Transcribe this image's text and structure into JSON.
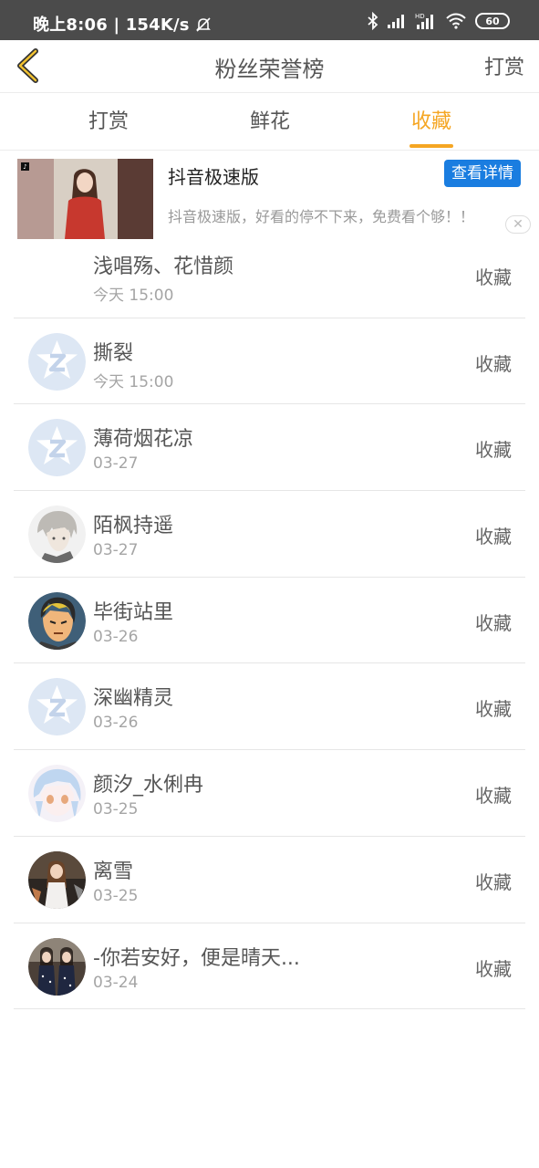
{
  "status": {
    "time": "晚上8:06",
    "speed": "154K/s",
    "battery": "60"
  },
  "header": {
    "title": "粉丝荣誉榜",
    "right_label": "打赏"
  },
  "tabs": [
    {
      "label": "打赏"
    },
    {
      "label": "鲜花"
    },
    {
      "label": "收藏"
    }
  ],
  "ad": {
    "title": "抖音极速版",
    "button": "查看详情",
    "desc": "抖音极速版，好看的停不下来，免费看个够！！"
  },
  "rows": [
    {
      "name": "浅唱殇、花惜颜",
      "date": "今天 15:00",
      "action": "收藏",
      "avatar": "hidden"
    },
    {
      "name": "撕裂",
      "date": "今天 15:00",
      "action": "收藏",
      "avatar": "default-q-icon"
    },
    {
      "name": "薄荷烟花凉",
      "date": "03-27",
      "action": "收藏",
      "avatar": "default-q-icon"
    },
    {
      "name": "陌枫持遥",
      "date": "03-27",
      "action": "收藏",
      "avatar": "anime-boy"
    },
    {
      "name": "毕街站里",
      "date": "03-26",
      "action": "收藏",
      "avatar": "cartoon-man"
    },
    {
      "name": "深幽精灵",
      "date": "03-26",
      "action": "收藏",
      "avatar": "default-q-icon"
    },
    {
      "name": "颜汐_水俐冉",
      "date": "03-25",
      "action": "收藏",
      "avatar": "anime-girl"
    },
    {
      "name": "离雪",
      "date": "03-25",
      "action": "收藏",
      "avatar": "photo-girl"
    },
    {
      "name": "-你若安好，便是晴天...",
      "date": "03-24",
      "action": "收藏",
      "avatar": "photo-group"
    }
  ],
  "colors": {
    "accent": "#f5a623",
    "ad_button": "#1a7de0",
    "status_bar": "#4b4b4b"
  }
}
